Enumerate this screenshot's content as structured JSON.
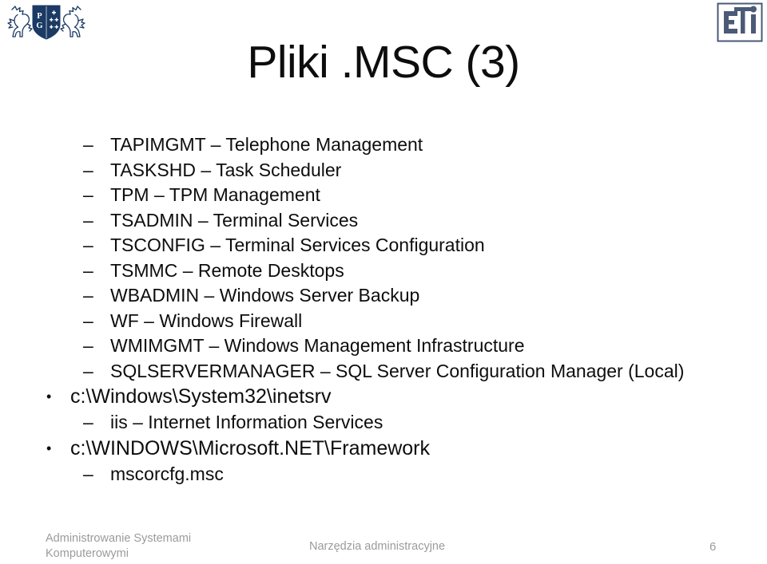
{
  "slide": {
    "title": "Pliki .MSC (3)",
    "page_number": "6"
  },
  "logos": {
    "left": {
      "name": "politechnika-gdanska-logo",
      "shield_letters": [
        "P",
        "G"
      ],
      "color": "#1b3a64"
    },
    "right": {
      "name": "eti-faculty-logo",
      "text": "ETI",
      "color": "#4a5a77"
    }
  },
  "bullets": [
    {
      "level": 2,
      "marker": "–",
      "text": "TAPIMGMT – Telephone Management"
    },
    {
      "level": 2,
      "marker": "–",
      "text": "TASKSHD – Task Scheduler"
    },
    {
      "level": 2,
      "marker": "–",
      "text": "TPM – TPM Management"
    },
    {
      "level": 2,
      "marker": "–",
      "text": "TSADMIN – Terminal Services"
    },
    {
      "level": 2,
      "marker": "–",
      "text": "TSCONFIG – Terminal Services Configuration"
    },
    {
      "level": 2,
      "marker": "–",
      "text": "TSMMC – Remote Desktops"
    },
    {
      "level": 2,
      "marker": "–",
      "text": "WBADMIN – Windows Server Backup"
    },
    {
      "level": 2,
      "marker": "–",
      "text": "WF – Windows Firewall"
    },
    {
      "level": 2,
      "marker": "–",
      "text": "WMIMGMT – Windows Management Infrastructure"
    },
    {
      "level": 2,
      "marker": "–",
      "text": "SQLSERVERMANAGER – SQL Server Configuration Manager (Local)"
    },
    {
      "level": 1,
      "marker": "•",
      "text": "c:\\Windows\\System32\\inetsrv"
    },
    {
      "level": 2,
      "marker": "–",
      "text": "iis – Internet Information Services"
    },
    {
      "level": 1,
      "marker": "•",
      "text": "c:\\WINDOWS\\Microsoft.NET\\Framework"
    },
    {
      "level": 2,
      "marker": "–",
      "text": "mscorcfg.msc"
    }
  ],
  "footer": {
    "left_line1": "Administrowanie Systemami",
    "left_line2": "Komputerowymi",
    "center": "Narzędzia administracyjne",
    "right": "6"
  },
  "colors": {
    "text": "#0d0d0d",
    "footer_text": "#9b9b9b",
    "background": "#ffffff",
    "pg_navy": "#1b3a64",
    "eti_slate": "#4a5a77"
  }
}
